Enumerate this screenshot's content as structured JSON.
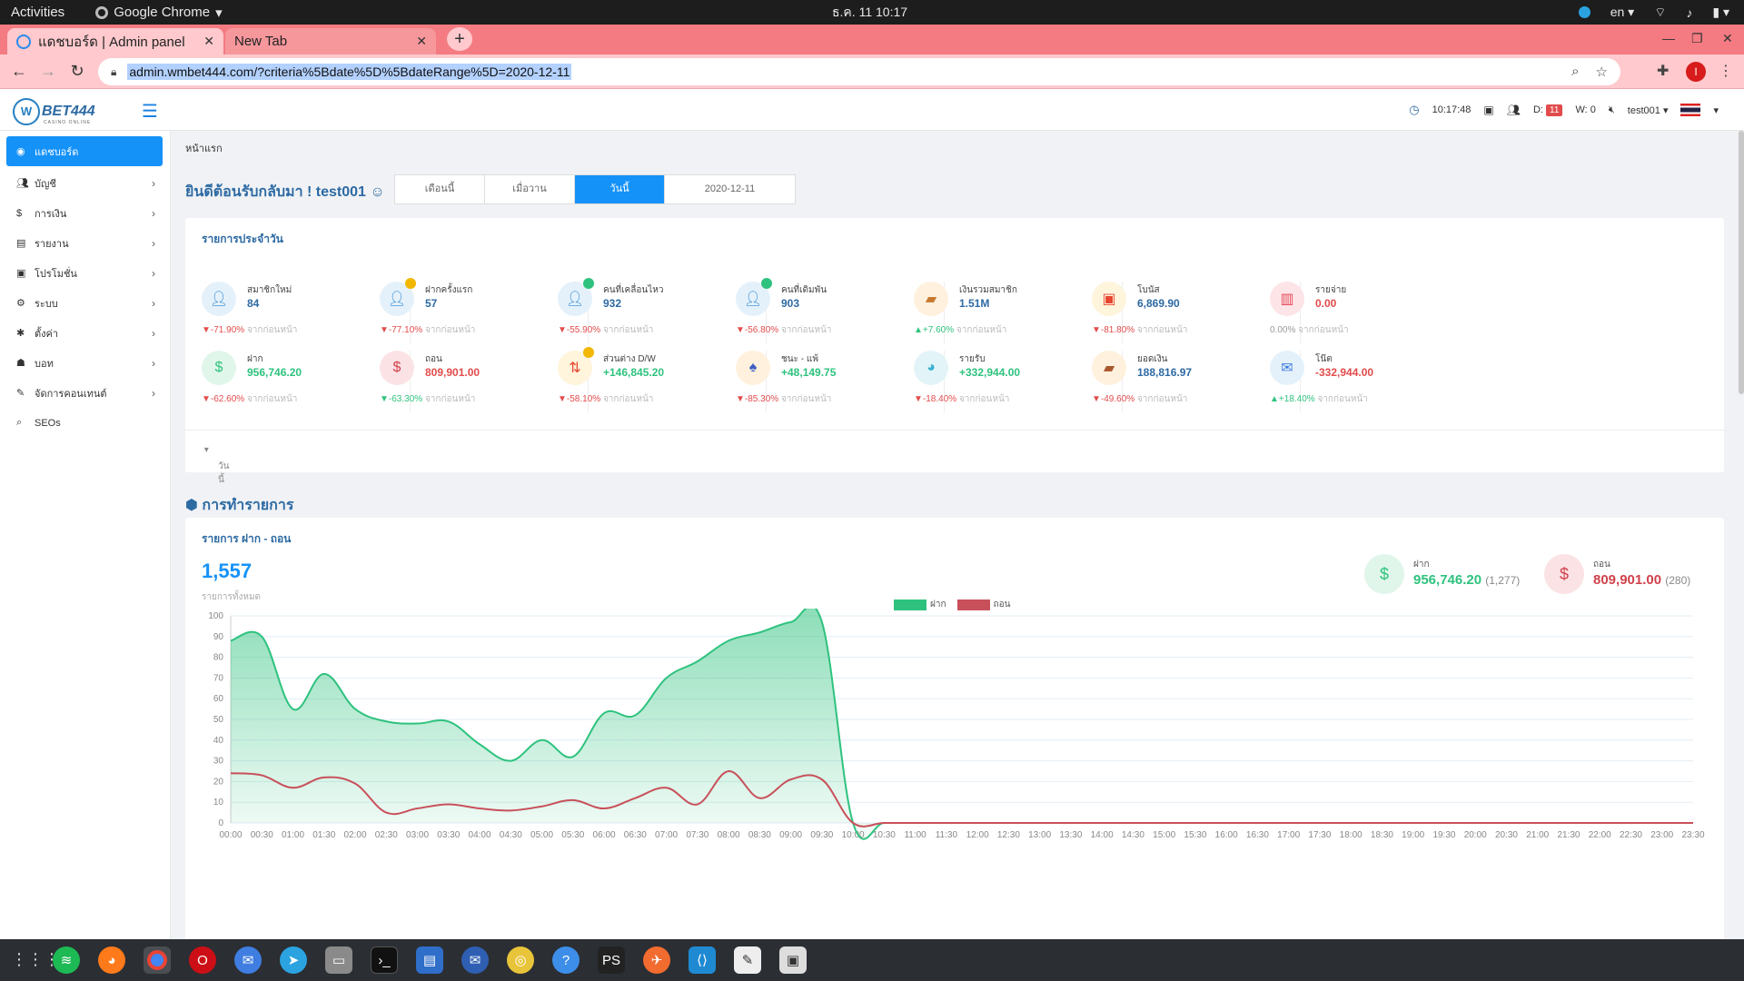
{
  "system": {
    "activities": "Activities",
    "app_name": "Google Chrome",
    "clock": "ธ.ค. 11  10:17",
    "lang": "en"
  },
  "browser": {
    "tabs": [
      {
        "title": "แดชบอร์ด | Admin panel"
      },
      {
        "title": "New Tab"
      }
    ],
    "url": "admin.wmbet444.com/?criteria%5Bdate%5D%5BdateRange%5D=2020-12-11",
    "profile_initial": "I"
  },
  "header": {
    "logo": "BET444",
    "logo_sub": "CASINO ONLINE",
    "time": "10:17:48",
    "d_label": "D:",
    "d_count": "11",
    "w_label": "W: 0",
    "user": "test001"
  },
  "sidebar": {
    "items": [
      {
        "label": "แดชบอร์ด"
      },
      {
        "label": "บัญชี"
      },
      {
        "label": "การเงิน"
      },
      {
        "label": "รายงาน"
      },
      {
        "label": "โปรโมชั่น"
      },
      {
        "label": "ระบบ"
      },
      {
        "label": "ตั้งค่า"
      },
      {
        "label": "บอท"
      },
      {
        "label": "จัดการคอนเทนต์"
      },
      {
        "label": "SEOs"
      }
    ]
  },
  "main": {
    "breadcrumb": "หน้าแรก",
    "welcome": "ยินดีต้อนรับกลับมา ! test001",
    "range_tabs": [
      "เดือนนี้",
      "เมื่อวาน",
      "วันนี้"
    ],
    "range_date": "2020-12-11",
    "daily": {
      "title": "รายการประจำวัน",
      "compare_text": "จากก่อนหน้า",
      "stats_row1": [
        {
          "label": "สมาชิกใหม่",
          "value": "84",
          "change": "▼-71.90%",
          "dir": "down"
        },
        {
          "label": "ฝากครั้งแรก",
          "value": "57",
          "change": "▼-77.10%",
          "dir": "down"
        },
        {
          "label": "คนที่เคลื่อนไหว",
          "value": "932",
          "change": "▼-55.90%",
          "dir": "down"
        },
        {
          "label": "คนที่เดิมพัน",
          "value": "903",
          "change": "▼-56.80%",
          "dir": "down"
        },
        {
          "label": "เงินรวมสมาชิก",
          "value": "1.51M",
          "change": "▲+7.60%",
          "dir": "up"
        },
        {
          "label": "โบนัส",
          "value": "6,869.90",
          "change": "▼-81.80%",
          "dir": "down"
        },
        {
          "label": "รายจ่าย",
          "value": "0.00",
          "change": "0.00%",
          "dir": "none"
        }
      ],
      "stats_row2": [
        {
          "label": "ฝาก",
          "value": "956,746.20",
          "change": "▼-62.60%",
          "dir": "down"
        },
        {
          "label": "ถอน",
          "value": "809,901.00",
          "change": "▼-63.30%",
          "dir": "up"
        },
        {
          "label": "ส่วนต่าง D/W",
          "value": "+146,845.20",
          "change": "▼-58.10%",
          "dir": "down"
        },
        {
          "label": "ชนะ - แพ้",
          "value": "+48,149.75",
          "change": "▼-85.30%",
          "dir": "down"
        },
        {
          "label": "รายรับ",
          "value": "+332,944.00",
          "change": "▼-18.40%",
          "dir": "down"
        },
        {
          "label": "ยอดเงิน",
          "value": "188,816.97",
          "change": "▼-49.60%",
          "dir": "down"
        },
        {
          "label": "โน๊ต",
          "value": "-332,944.00",
          "change": "▲+18.40%",
          "dir": "up"
        }
      ],
      "footer_select": "วันนี้"
    },
    "transactions": {
      "section_title": "การทำรายการ",
      "card_title": "รายการ ฝาก - ถอน",
      "total": "1,557",
      "total_label": "รายการทั้งหมด",
      "deposit_label": "ฝาก",
      "deposit_value": "956,746.20",
      "deposit_count": "(1,277)",
      "withdraw_label": "ถอน",
      "withdraw_value": "809,901.00",
      "withdraw_count": "(280)"
    }
  },
  "colors": {
    "accent": "#1592f8",
    "deposit": "#2ec27e",
    "withdraw": "#c8505a",
    "title": "#2d6aa3",
    "tab_strip": "#f47b82"
  },
  "chart_data": {
    "type": "area",
    "ylim": [
      0,
      100
    ],
    "yticks": [
      0,
      10,
      20,
      30,
      40,
      50,
      60,
      70,
      80,
      90,
      100
    ],
    "x": [
      "00:00",
      "00:30",
      "01:00",
      "01:30",
      "02:00",
      "02:30",
      "03:00",
      "03:30",
      "04:00",
      "04:30",
      "05:00",
      "05:30",
      "06:00",
      "06:30",
      "07:00",
      "07:30",
      "08:00",
      "08:30",
      "09:00",
      "09:30",
      "10:00",
      "10:30",
      "11:00",
      "11:30",
      "12:00",
      "12:30",
      "13:00",
      "13:30",
      "14:00",
      "14:30",
      "15:00",
      "15:30",
      "16:00",
      "16:30",
      "17:00",
      "17:30",
      "18:00",
      "18:30",
      "19:00",
      "19:30",
      "20:00",
      "20:30",
      "21:00",
      "21:30",
      "22:00",
      "22:30",
      "23:00",
      "23:30"
    ],
    "series": [
      {
        "name": "ฝาก",
        "color": "#2ec27e",
        "values": [
          88,
          90,
          55,
          72,
          55,
          49,
          48,
          49,
          38,
          30,
          40,
          32,
          53,
          52,
          70,
          78,
          88,
          92,
          97,
          97,
          0,
          0,
          0,
          0,
          0,
          0,
          0,
          0,
          0,
          0,
          0,
          0,
          0,
          0,
          0,
          0,
          0,
          0,
          0,
          0,
          0,
          0,
          0,
          0,
          0,
          0,
          0,
          0
        ]
      },
      {
        "name": "ถอน",
        "color": "#c8505a",
        "values": [
          24,
          23,
          17,
          22,
          19,
          5,
          7,
          9,
          7,
          6,
          8,
          11,
          7,
          12,
          17,
          9,
          25,
          12,
          21,
          21,
          0,
          0,
          0,
          0,
          0,
          0,
          0,
          0,
          0,
          0,
          0,
          0,
          0,
          0,
          0,
          0,
          0,
          0,
          0,
          0,
          0,
          0,
          0,
          0,
          0,
          0,
          0,
          0
        ]
      }
    ]
  }
}
